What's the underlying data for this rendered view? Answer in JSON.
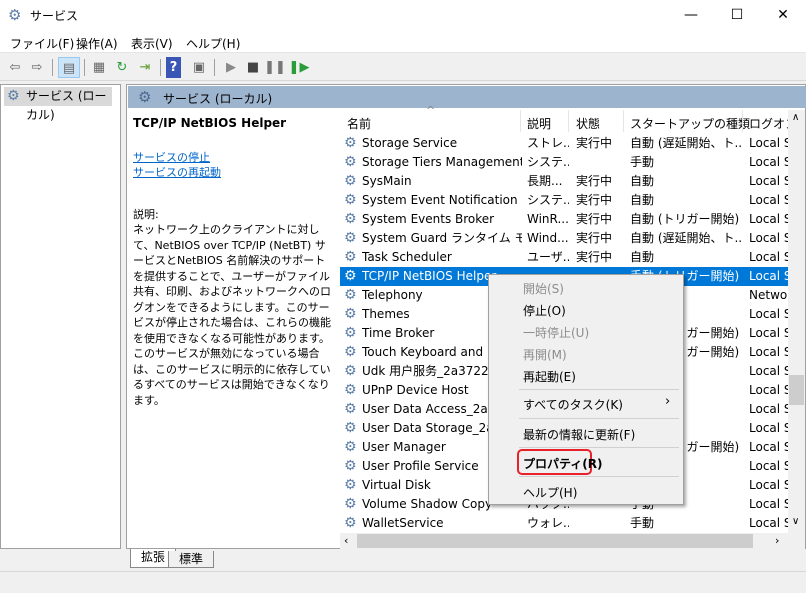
{
  "window": {
    "title": "サービス",
    "minimize": "—",
    "maximize": "☐",
    "close": "✕"
  },
  "menubar": [
    "ファイル(F)",
    "操作(A)",
    "表示(V)",
    "ヘルプ(H)"
  ],
  "toolbar": [
    "back-icon",
    "forward-icon",
    "show-hide-tree-icon",
    "properties-icon",
    "refresh-icon",
    "export-list-icon",
    "help-icon",
    "action-pane-icon",
    "start-service-icon",
    "stop-service-icon",
    "pause-service-icon",
    "restart-service-icon"
  ],
  "tree": {
    "item": "サービス (ローカル)"
  },
  "pane": {
    "title": "サービス (ローカル)"
  },
  "details": {
    "service_name": "TCP/IP NetBIOS Helper",
    "links": [
      "サービスの停止",
      "サービスの再起動"
    ],
    "desc_label": "説明:",
    "description": "ネットワーク上のクライアントに対して、NetBIOS over TCP/IP (NetBT) サービスとNetBIOS 名前解決のサポートを提供することで、ユーザーがファイル共有、印刷、およびネットワークへのログオンをできるようにします。このサービスが停止された場合は、これらの機能を使用できなくなる可能性があります。このサービスが無効になっている場合は、このサービスに明示的に依存しているすべてのサービスは開始できなくなります。"
  },
  "columns": [
    "名前",
    "説明",
    "状態",
    "スタートアップの種類",
    "ログオン"
  ],
  "rows": [
    {
      "name": "Storage Service",
      "desc": "ストレ...",
      "status": "実行中",
      "startup": "自動 (遅延開始、ト...",
      "logon": "Local S"
    },
    {
      "name": "Storage Tiers Management",
      "desc": "システ...",
      "status": "",
      "startup": "手動",
      "logon": "Local S"
    },
    {
      "name": "SysMain",
      "desc": "長期...",
      "status": "実行中",
      "startup": "自動",
      "logon": "Local S"
    },
    {
      "name": "System Event Notification S...",
      "desc": "システ...",
      "status": "実行中",
      "startup": "自動",
      "logon": "Local S"
    },
    {
      "name": "System Events Broker",
      "desc": "WinR...",
      "status": "実行中",
      "startup": "自動 (トリガー開始)",
      "logon": "Local S"
    },
    {
      "name": "System Guard ランタイム モニ...",
      "desc": "Wind...",
      "status": "実行中",
      "startup": "自動 (遅延開始、ト...",
      "logon": "Local S"
    },
    {
      "name": "Task Scheduler",
      "desc": "ユーザ...",
      "status": "実行中",
      "startup": "自動",
      "logon": "Local S"
    },
    {
      "name": "TCP/IP NetBIOS Helper",
      "desc": "",
      "status": "",
      "startup": "手動 (トリガー開始)",
      "logon": "Local S",
      "selected": true
    },
    {
      "name": "Telephony",
      "desc": "",
      "status": "",
      "startup": "",
      "logon": "Networ"
    },
    {
      "name": "Themes",
      "desc": "",
      "status": "",
      "startup": "",
      "logon": "Local S"
    },
    {
      "name": "Time Broker",
      "desc": "",
      "status": "",
      "startup": "手動 (トリガー開始)",
      "logon": "Local S"
    },
    {
      "name": "Touch Keyboard and Handwriting",
      "desc": "",
      "status": "",
      "startup": "手動 (トリガー開始)",
      "logon": "Local S"
    },
    {
      "name": "Udk 用户服务_2a3722a",
      "desc": "",
      "status": "",
      "startup": "",
      "logon": "Local S"
    },
    {
      "name": "UPnP Device Host",
      "desc": "",
      "status": "",
      "startup": "",
      "logon": "Local S"
    },
    {
      "name": "User Data Access_2a3722a",
      "desc": "",
      "status": "",
      "startup": "",
      "logon": "Local S"
    },
    {
      "name": "User Data Storage_2a3722a",
      "desc": "",
      "status": "",
      "startup": "",
      "logon": "Local S"
    },
    {
      "name": "User Manager",
      "desc": "",
      "status": "",
      "startup": "自動 (トリガー開始)",
      "logon": "Local S"
    },
    {
      "name": "User Profile Service",
      "desc": "",
      "status": "",
      "startup": "",
      "logon": "Local S"
    },
    {
      "name": "Virtual Disk",
      "desc": "",
      "status": "",
      "startup": "",
      "logon": "Local S"
    },
    {
      "name": "Volume Shadow Copy",
      "desc": "バック...",
      "status": "",
      "startup": "手動",
      "logon": "Local S"
    },
    {
      "name": "WalletService",
      "desc": "ウォレ...",
      "status": "",
      "startup": "手動",
      "logon": "Local S"
    }
  ],
  "context_menu": [
    {
      "label": "開始(S)",
      "disabled": true
    },
    {
      "label": "停止(O)",
      "disabled": false
    },
    {
      "label": "一時停止(U)",
      "disabled": true
    },
    {
      "label": "再開(M)",
      "disabled": true
    },
    {
      "label": "再起動(E)",
      "disabled": false
    },
    {
      "label": "すべてのタスク(K)",
      "disabled": false,
      "submenu": "›"
    },
    {
      "label": "最新の情報に更新(F)",
      "disabled": false
    },
    {
      "label": "プロパティ(R)",
      "disabled": false,
      "highlighted": true
    },
    {
      "label": "ヘルプ(H)",
      "disabled": false
    }
  ],
  "tabs": [
    "拡張",
    "標準"
  ],
  "colors": {
    "selection": "#0078d7",
    "header_band": "#9db4cf",
    "highlight_outline": "#e8212a",
    "link": "#0066cc"
  }
}
